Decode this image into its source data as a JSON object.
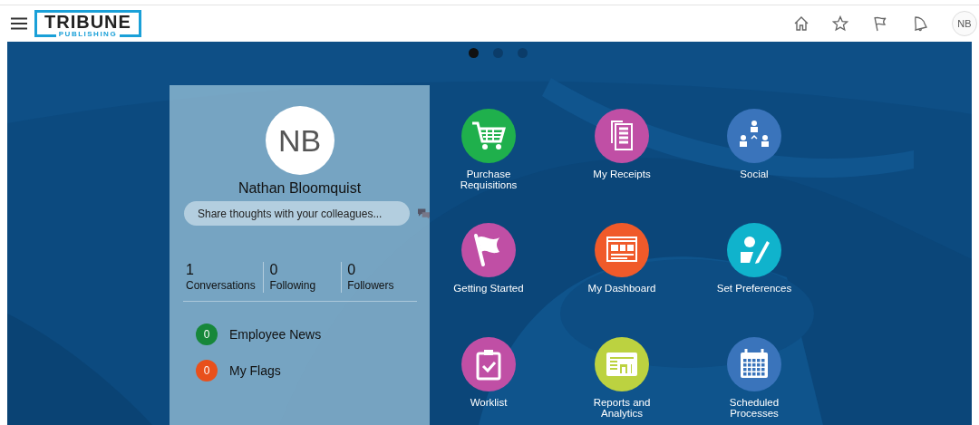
{
  "header": {
    "logo": {
      "name": "TRIBUNE",
      "tagline": "PUBLISHING"
    },
    "user_initials": "NB"
  },
  "carousel": {
    "dots": [
      {
        "selected": true
      },
      {
        "selected": false
      },
      {
        "selected": false
      }
    ]
  },
  "profile": {
    "initials": "NB",
    "name": "Nathan Bloomquist",
    "share_placeholder": "Share thoughts with your colleagues...",
    "stats": [
      {
        "count": "1",
        "label": "Conversations"
      },
      {
        "count": "0",
        "label": "Following"
      },
      {
        "count": "0",
        "label": "Followers"
      }
    ],
    "feeds": [
      {
        "count": "0",
        "label": "Employee News",
        "color": "#17873a"
      },
      {
        "count": "0",
        "label": "My Flags",
        "color": "#e8501c"
      }
    ]
  },
  "apps": [
    {
      "label": "Purchase Requisitions",
      "kind": "cart",
      "color": "#1fb04c"
    },
    {
      "label": "My Receipts",
      "kind": "receipts",
      "color": "#c04fa5"
    },
    {
      "label": "Social",
      "kind": "social",
      "color": "#3a74bb"
    },
    {
      "label": "Getting Started",
      "kind": "flag",
      "color": "#c04fa5"
    },
    {
      "label": "My Dashboard",
      "kind": "dashboard",
      "color": "#f05a2a"
    },
    {
      "label": "Set Preferences",
      "kind": "preferences",
      "color": "#10b3cc"
    },
    {
      "label": "Worklist",
      "kind": "worklist",
      "color": "#c04fa5"
    },
    {
      "label": "Reports and Analytics",
      "kind": "reports",
      "color": "#bcd240"
    },
    {
      "label": "Scheduled Processes",
      "kind": "calendar",
      "color": "#3a74bb"
    }
  ]
}
